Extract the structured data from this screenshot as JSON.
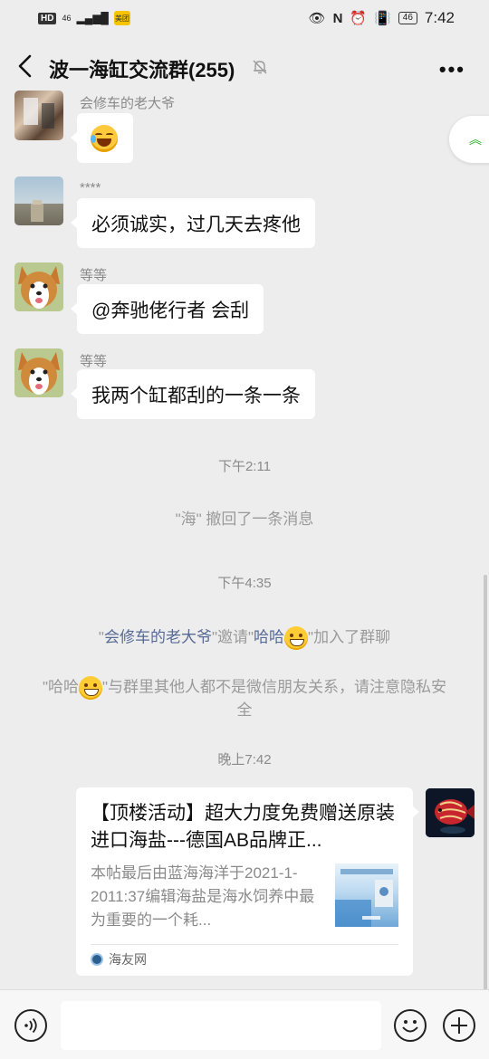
{
  "status_bar": {
    "hd": "HD",
    "signal": "46",
    "app_badge": "美团",
    "battery": "46",
    "time": "7:42"
  },
  "header": {
    "title": "波一海缸交流群(255)"
  },
  "messages": [
    {
      "nick": "会修车的老大爷",
      "content": "😂"
    },
    {
      "nick": "****",
      "content": "必须诚实，过几天去疼他"
    },
    {
      "nick": "等等",
      "content": "@奔驰佬行者  会刮"
    },
    {
      "nick": "等等",
      "content": "我两个缸都刮的一条一条"
    }
  ],
  "system": {
    "time1": "下午2:11",
    "recall": "\"海\" 撤回了一条消息",
    "time2": "下午4:35",
    "invite_q1": "\"",
    "invite_name1": "会修车的老大爷",
    "invite_mid": "\"邀请\"",
    "invite_name2": "哈哈",
    "invite_end": "\"加入了群聊",
    "notice_q": "\"哈哈",
    "notice_rest": "\"与群里其他人都不是微信朋友关系，请注意隐私安全",
    "time3": "晚上7:42"
  },
  "link_card": {
    "title": "【顶楼活动】超大力度免费赠送原装进口海盐---德国AB品牌正...",
    "description": "本帖最后由蓝海海洋于2021-1-2011:37编辑海盐是海水饲养中最为重要的一个耗...",
    "source": "海友网"
  },
  "input": {
    "placeholder": ""
  },
  "colors": {
    "background": "#ededed",
    "link_name": "#576b95",
    "system_text": "#9a9a9a"
  }
}
